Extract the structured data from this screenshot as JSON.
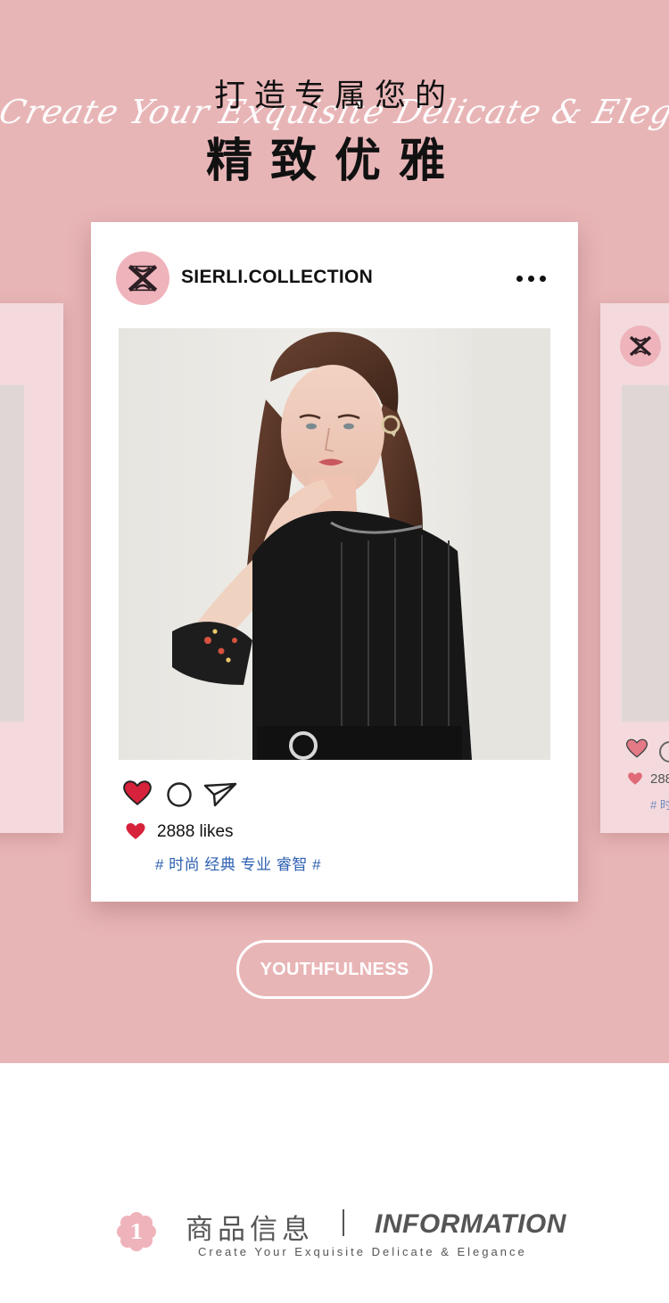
{
  "hero": {
    "script_tagline": "Create Your Exquisite Delicate & Elegance",
    "title_line1": "打造专属您的",
    "title_line2": "精致优雅"
  },
  "post": {
    "username": "SIERLI.COLLECTION",
    "likes_text": "2888 likes",
    "hashtags": "# 时尚 经典 专业 睿智 #",
    "icons": [
      "heart-icon",
      "comment-icon",
      "share-icon",
      "more-dots-icon"
    ]
  },
  "side_card_right": {
    "likes_partial": "288",
    "tag_partial": "# 时"
  },
  "cta": {
    "label": "YOUTHFULNESS"
  },
  "section": {
    "number": "1",
    "title_cn": "商品信息",
    "title_en": "INFORMATION",
    "subtitle": "Create Your Exquisite Delicate & Elegance"
  },
  "colors": {
    "background_pink": "#e8b5b7",
    "card_white": "#ffffff",
    "heart_red": "#d6223a",
    "hashtag_blue": "#2d5fb1",
    "text_gray": "#555555"
  }
}
